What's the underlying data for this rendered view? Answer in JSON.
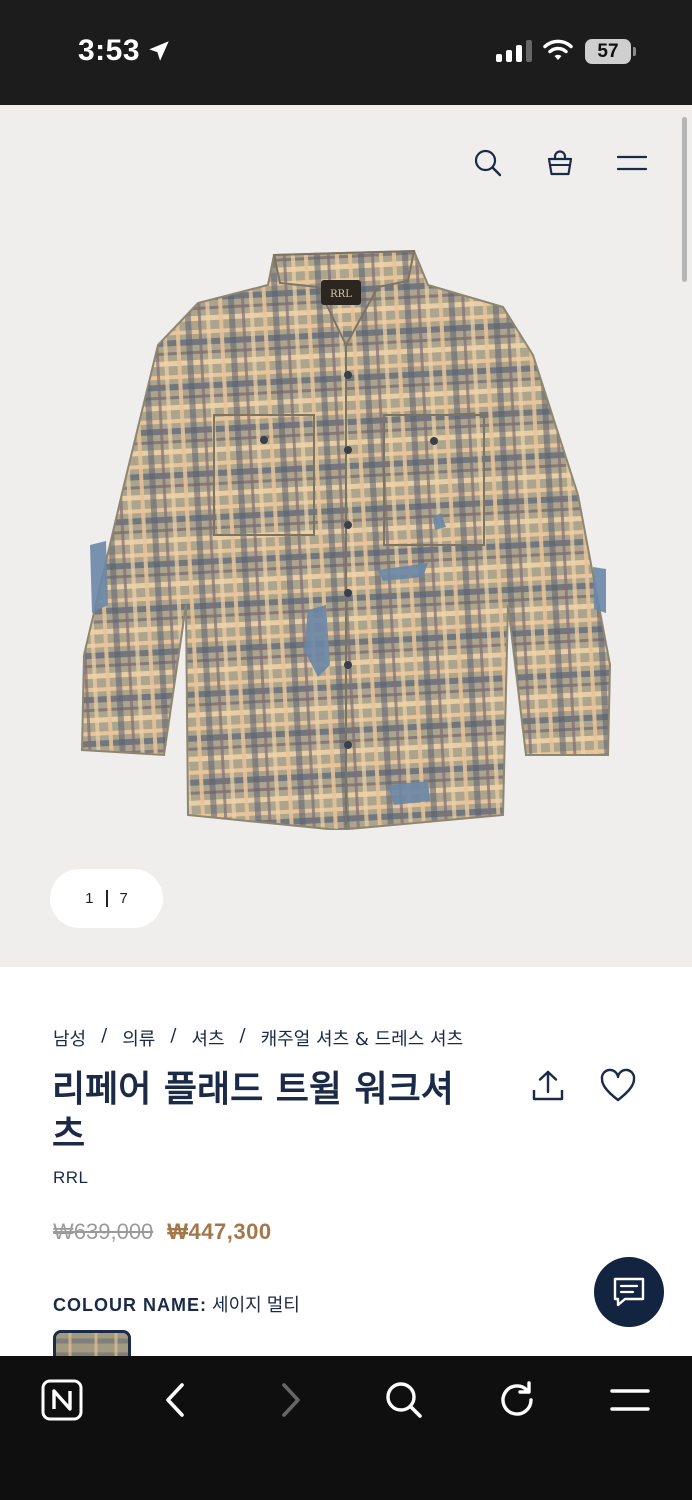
{
  "status": {
    "time": "3:53",
    "battery": "57"
  },
  "hero": {
    "counter": {
      "current": "1",
      "total": "7"
    }
  },
  "product": {
    "breadcrumb": [
      "남성",
      "의류",
      "셔츠",
      "캐주얼 셔츠 & 드레스 셔츠"
    ],
    "breadcrumb_sep": "/",
    "title": "리페어 플래드 트윌 워크셔츠",
    "brand": "RRL",
    "original_price": "₩639,000",
    "sale_price": "₩447,300",
    "colour_label": "COLOUR NAME:",
    "colour_value": "세이지 멀티"
  },
  "icons": {
    "header": [
      "search-icon",
      "shopping-bag-icon",
      "menu-icon"
    ],
    "product": [
      "share-icon",
      "heart-icon",
      "chat-icon"
    ],
    "toolbar": [
      "naver-n-icon",
      "back-arrow-icon",
      "forward-arrow-icon",
      "search-icon",
      "refresh-icon",
      "menu-icon"
    ]
  },
  "colors": {
    "navy": "#1b2a46",
    "sale": "#a4774a",
    "chat_bg": "#132441"
  }
}
